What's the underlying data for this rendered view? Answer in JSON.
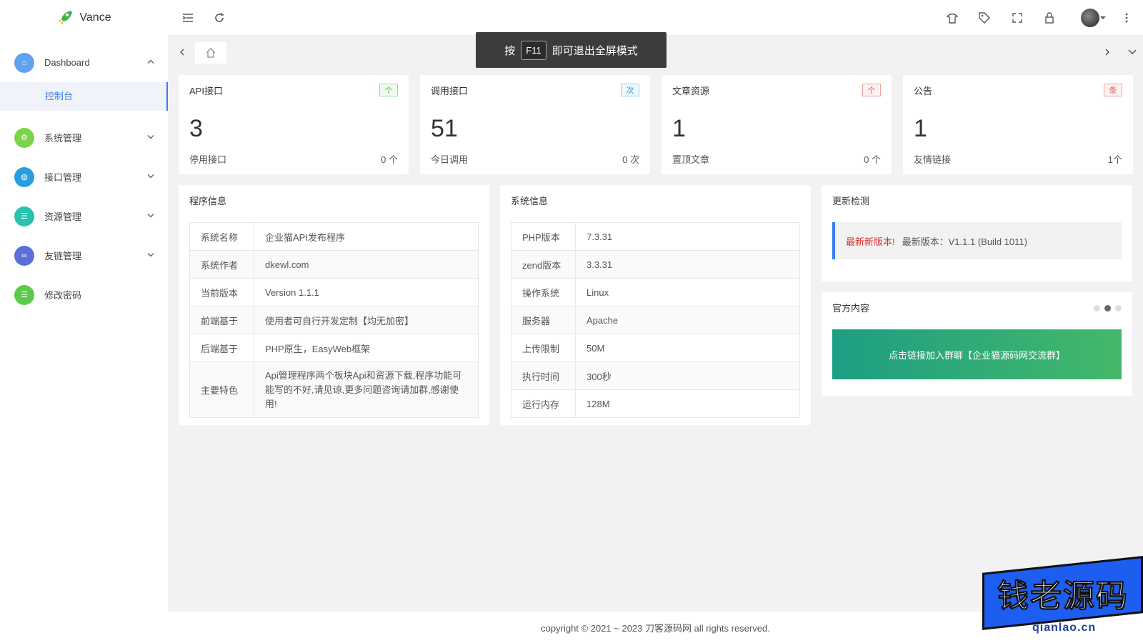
{
  "logo": {
    "name": "Vance"
  },
  "sidebar": {
    "items": [
      {
        "label": "Dashboard",
        "color": "#5fa3f0"
      },
      {
        "label": "系统管理",
        "color": "#7bd447"
      },
      {
        "label": "接口管理",
        "color": "#2a9dde"
      },
      {
        "label": "资源管理",
        "color": "#27c3b0"
      },
      {
        "label": "友链管理",
        "color": "#5a6fd8"
      },
      {
        "label": "修改密码",
        "color": "#5dc94b"
      }
    ],
    "sub_item": "控制台"
  },
  "toast": {
    "prefix": "按",
    "key": "F11",
    "suffix": "即可退出全屏模式"
  },
  "stats": [
    {
      "title": "API接口",
      "badge": "个",
      "badge_color": "#5cb85c",
      "value": "3",
      "sub_label": "停用接口",
      "sub_value": "0 个"
    },
    {
      "title": "调用接口",
      "badge": "次",
      "badge_color": "#2a9dde",
      "value": "51",
      "sub_label": "今日调用",
      "sub_value": "0 次"
    },
    {
      "title": "文章资源",
      "badge": "个",
      "badge_color": "#e25555",
      "value": "1",
      "sub_label": "置顶文章",
      "sub_value": "0 个"
    },
    {
      "title": "公告",
      "badge": "条",
      "badge_color": "#e25555",
      "value": "1",
      "sub_label": "友情链接",
      "sub_value": "1个"
    }
  ],
  "program_info": {
    "title": "程序信息",
    "rows": [
      {
        "k": "系统名称",
        "v": "企业猫API发布程序"
      },
      {
        "k": "系统作者",
        "v": "dkewl.com"
      },
      {
        "k": "当前版本",
        "v": "Version 1.1.1"
      },
      {
        "k": "前端基于",
        "v": "使用者可自行开发定制【均无加密】"
      },
      {
        "k": "后端基于",
        "v": "PHP原生，EasyWeb框架"
      },
      {
        "k": "主要特色",
        "v": "Api管理程序两个板块Api和资源下载,程序功能可能写的不好,请见谅,更多问题咨询请加群,感谢使用!"
      }
    ]
  },
  "system_info": {
    "title": "系统信息",
    "rows": [
      {
        "k": "PHP版本",
        "v": "7.3.31"
      },
      {
        "k": "zend版本",
        "v": "3.3.31"
      },
      {
        "k": "操作系统",
        "v": "Linux"
      },
      {
        "k": "服务器",
        "v": "Apache"
      },
      {
        "k": "上传限制",
        "v": "50M"
      },
      {
        "k": "执行时间",
        "v": "300秒"
      },
      {
        "k": "运行内存",
        "v": "128M"
      }
    ]
  },
  "update_check": {
    "title": "更新检测",
    "highlight": "最新新版本!",
    "text": "最新版本：V1.1.1 (Build 1011)"
  },
  "official": {
    "title": "官方内容",
    "button": "点击链接加入群聊【企业猫源码网交流群】"
  },
  "footer": {
    "text": "copyright © 2021 ~ 2023 刀客源码网 all rights reserved."
  },
  "watermark": {
    "text": "钱老源码",
    "url": "qianlao.cn"
  }
}
